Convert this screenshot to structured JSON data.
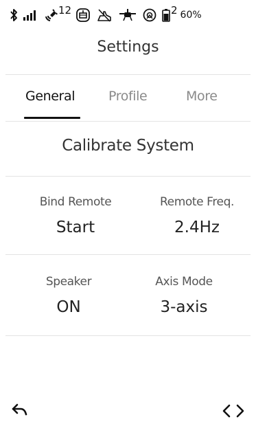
{
  "status_bar": {
    "icons": [
      "bluetooth-icon",
      "signal-bars-icon",
      "satellite-icon",
      "gimbal-icon",
      "hand-icon",
      "drone-icon",
      "rotation-icon",
      "battery-icon"
    ],
    "satellite_count": "12",
    "battery_index": "2",
    "battery_percent": "60%"
  },
  "header": {
    "title": "Settings"
  },
  "tabs": [
    {
      "label": "General",
      "active": true
    },
    {
      "label": "Profile",
      "active": false
    },
    {
      "label": "More",
      "active": false
    }
  ],
  "general": {
    "calibrate_label": "Calibrate System",
    "settings": [
      {
        "label": "Bind Remote",
        "value": "Start"
      },
      {
        "label": "Remote Freq.",
        "value": "2.4Hz"
      },
      {
        "label": "Speaker",
        "value": "ON"
      },
      {
        "label": "Axis Mode",
        "value": "3-axis"
      }
    ]
  },
  "nav": {
    "back_icon": "back-arrow-icon",
    "code_icon": "code-brackets-icon"
  }
}
